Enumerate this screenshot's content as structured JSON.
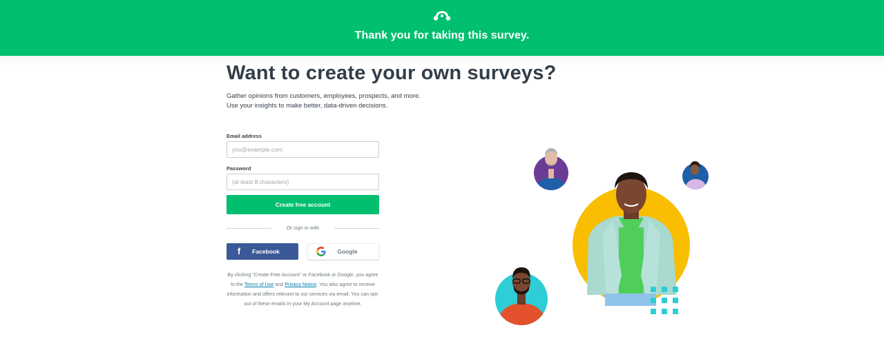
{
  "banner": {
    "logo_icon": "surveymonkey-logo-icon",
    "message": "Thank you for taking this survey.",
    "background_color": "#00bf6f"
  },
  "main": {
    "heading": "Want to create your own surveys?",
    "subtext_line1": "Gather opinions from customers, employees, prospects, and more.",
    "subtext_line2": "Use your insights to make better, data-driven decisions."
  },
  "form": {
    "email_label": "Email address",
    "email_placeholder": "you@example.com",
    "password_label": "Password",
    "password_placeholder": "(at least 8 characters)",
    "create_button": "Create free account",
    "create_button_color": "#00bf6f",
    "divider_text": "Or sign in with",
    "facebook_button": "Facebook",
    "facebook_color": "#3b5998",
    "google_button": "Google"
  },
  "legal": {
    "part1": "By clicking “Create Free Account” or Facebook or Google, you agree to the",
    "terms_link": "Terms of Use",
    "and": "and",
    "privacy_link": "Privacy Notice",
    "part2": ". You also agree to receive information and offers relevant to our services via email. You can opt-out of these emails in your My Account page anytime.",
    "link_color": "#007faa"
  },
  "illustration": {
    "accent_yellow": "#f9be00",
    "accent_teal": "#2fcdd5",
    "accent_purple": "#6c3b96",
    "accent_blue": "#1f5fa8"
  }
}
